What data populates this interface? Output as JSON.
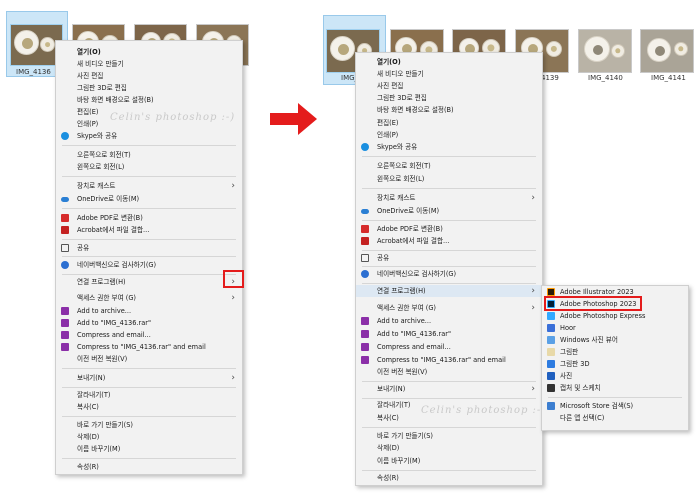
{
  "watermark": "Celin's photoshop :-)",
  "left": {
    "file_label": "IMG_4136",
    "menu": [
      "열기(O)",
      "새 비디오 만들기",
      "사진 편집",
      "그림판 3D로 편집",
      "바탕 화면 배경으로 설정(B)",
      "편집(E)",
      "인쇄(P)",
      "Skype와 공유",
      "오른쪽으로 회전(T)",
      "왼쪽으로 회전(L)",
      "장치로 캐스트",
      "OneDrive로 이동(M)",
      "Adobe PDF로 변환(B)",
      "Acrobat에서 파일 결합...",
      "공유",
      "네이버백신으로 검사하기(G)",
      "연결 프로그램(H)",
      "액세스 권한 부여 (G)",
      "Add to archive...",
      "Add to \"IMG_4136.rar\"",
      "Compress and email...",
      "Compress to \"IMG_4136.rar\" and email",
      "이전 버전 복원(V)",
      "보내기(N)",
      "잘라내기(T)",
      "복사(C)",
      "바로 가기 만들기(S)",
      "삭제(D)",
      "이름 바꾸기(M)",
      "속성(R)"
    ]
  },
  "right": {
    "files": [
      "IMG_4",
      "4139",
      "IMG_4140",
      "IMG_4141"
    ],
    "menu": [
      "열기(O)",
      "새 비디오 만들기",
      "사진 편집",
      "그림판 3D로 편집",
      "바탕 화면 배경으로 설정(B)",
      "편집(E)",
      "인쇄(P)",
      "Skype와 공유",
      "오른쪽으로 회전(T)",
      "왼쪽으로 회전(L)",
      "장치로 캐스트",
      "OneDrive로 이동(M)",
      "Adobe PDF로 변환(B)",
      "Acrobat에서 파일 결합...",
      "공유",
      "네이버백신으로 검사하기(G)",
      "연결 프로그램(H)",
      "액세스 권한 부여 (G)",
      "Add to archive...",
      "Add to \"IMG_4136.rar\"",
      "Compress and email...",
      "Compress to \"IMG_4136.rar\" and email",
      "이전 버전 복원(V)",
      "보내기(N)",
      "잘라내기(T)",
      "복사(C)",
      "바로 가기 만들기(S)",
      "삭제(D)",
      "이름 바꾸기(M)",
      "속성(R)"
    ],
    "submenu": [
      "Adobe Illustrator 2023",
      "Adobe Photoshop 2023",
      "Adobe Photoshop Express",
      "Hoor",
      "Windows 사진 뷰어",
      "그림판",
      "그림판 3D",
      "사진",
      "캡처 및 스케치",
      "Microsoft Store 검색(S)",
      "다른 앱 선택(C)"
    ]
  },
  "colors": {
    "highlight_box": "#e41c1c",
    "arrow": "#e41c1c",
    "selection": "#cce6f7"
  }
}
